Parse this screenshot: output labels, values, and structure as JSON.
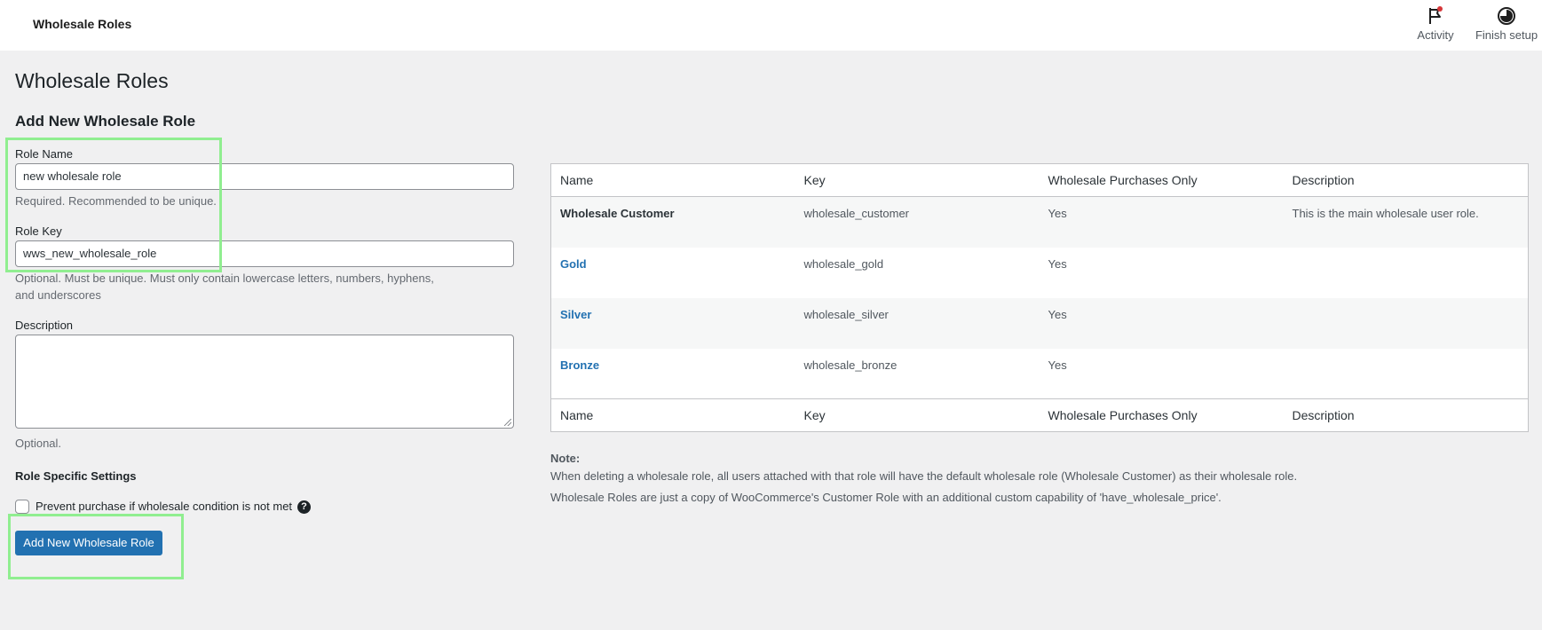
{
  "topbar": {
    "title": "Wholesale Roles",
    "activity_label": "Activity",
    "finish_label": "Finish setup"
  },
  "page": {
    "title": "Wholesale Roles",
    "section_title": "Add New Wholesale Role"
  },
  "form": {
    "role_name_label": "Role Name",
    "role_name_value": "new wholesale role",
    "role_name_help": "Required. Recommended to be unique.",
    "role_key_label": "Role Key",
    "role_key_value": "wws_new_wholesale_role",
    "role_key_help_line1": "Optional. Must be unique. Must only contain lowercase letters, numbers, hyphens,",
    "role_key_help_line2": "and underscores",
    "description_label": "Description",
    "description_value": "",
    "description_help": "Optional.",
    "settings_title": "Role Specific Settings",
    "prevent_purchase_label": "Prevent purchase if wholesale condition is not met",
    "help_icon_glyph": "?",
    "submit_label": "Add New Wholesale Role"
  },
  "table": {
    "columns": [
      "Name",
      "Key",
      "Wholesale Purchases Only",
      "Description"
    ],
    "rows": [
      {
        "name": "Wholesale Customer",
        "key": "wholesale_customer",
        "purchases_only": "Yes",
        "description": "This is the main wholesale user role."
      },
      {
        "name": "Gold",
        "key": "wholesale_gold",
        "purchases_only": "Yes",
        "description": ""
      },
      {
        "name": "Silver",
        "key": "wholesale_silver",
        "purchases_only": "Yes",
        "description": ""
      },
      {
        "name": "Bronze",
        "key": "wholesale_bronze",
        "purchases_only": "Yes",
        "description": ""
      }
    ]
  },
  "notes": {
    "heading": "Note:",
    "line1": "When deleting a wholesale role, all users attached with that role will have the default wholesale role (Wholesale Customer) as their wholesale role.",
    "line2": "Wholesale Roles are just a copy of WooCommerce's Customer Role with an additional custom capability of 'have_wholesale_price'."
  },
  "icons": {
    "activity": "flag-icon",
    "finish_setup": "progress-circle-icon"
  },
  "colors": {
    "primary": "#2271b1",
    "highlight": "#90ee90",
    "notification_dot": "#d63638"
  }
}
